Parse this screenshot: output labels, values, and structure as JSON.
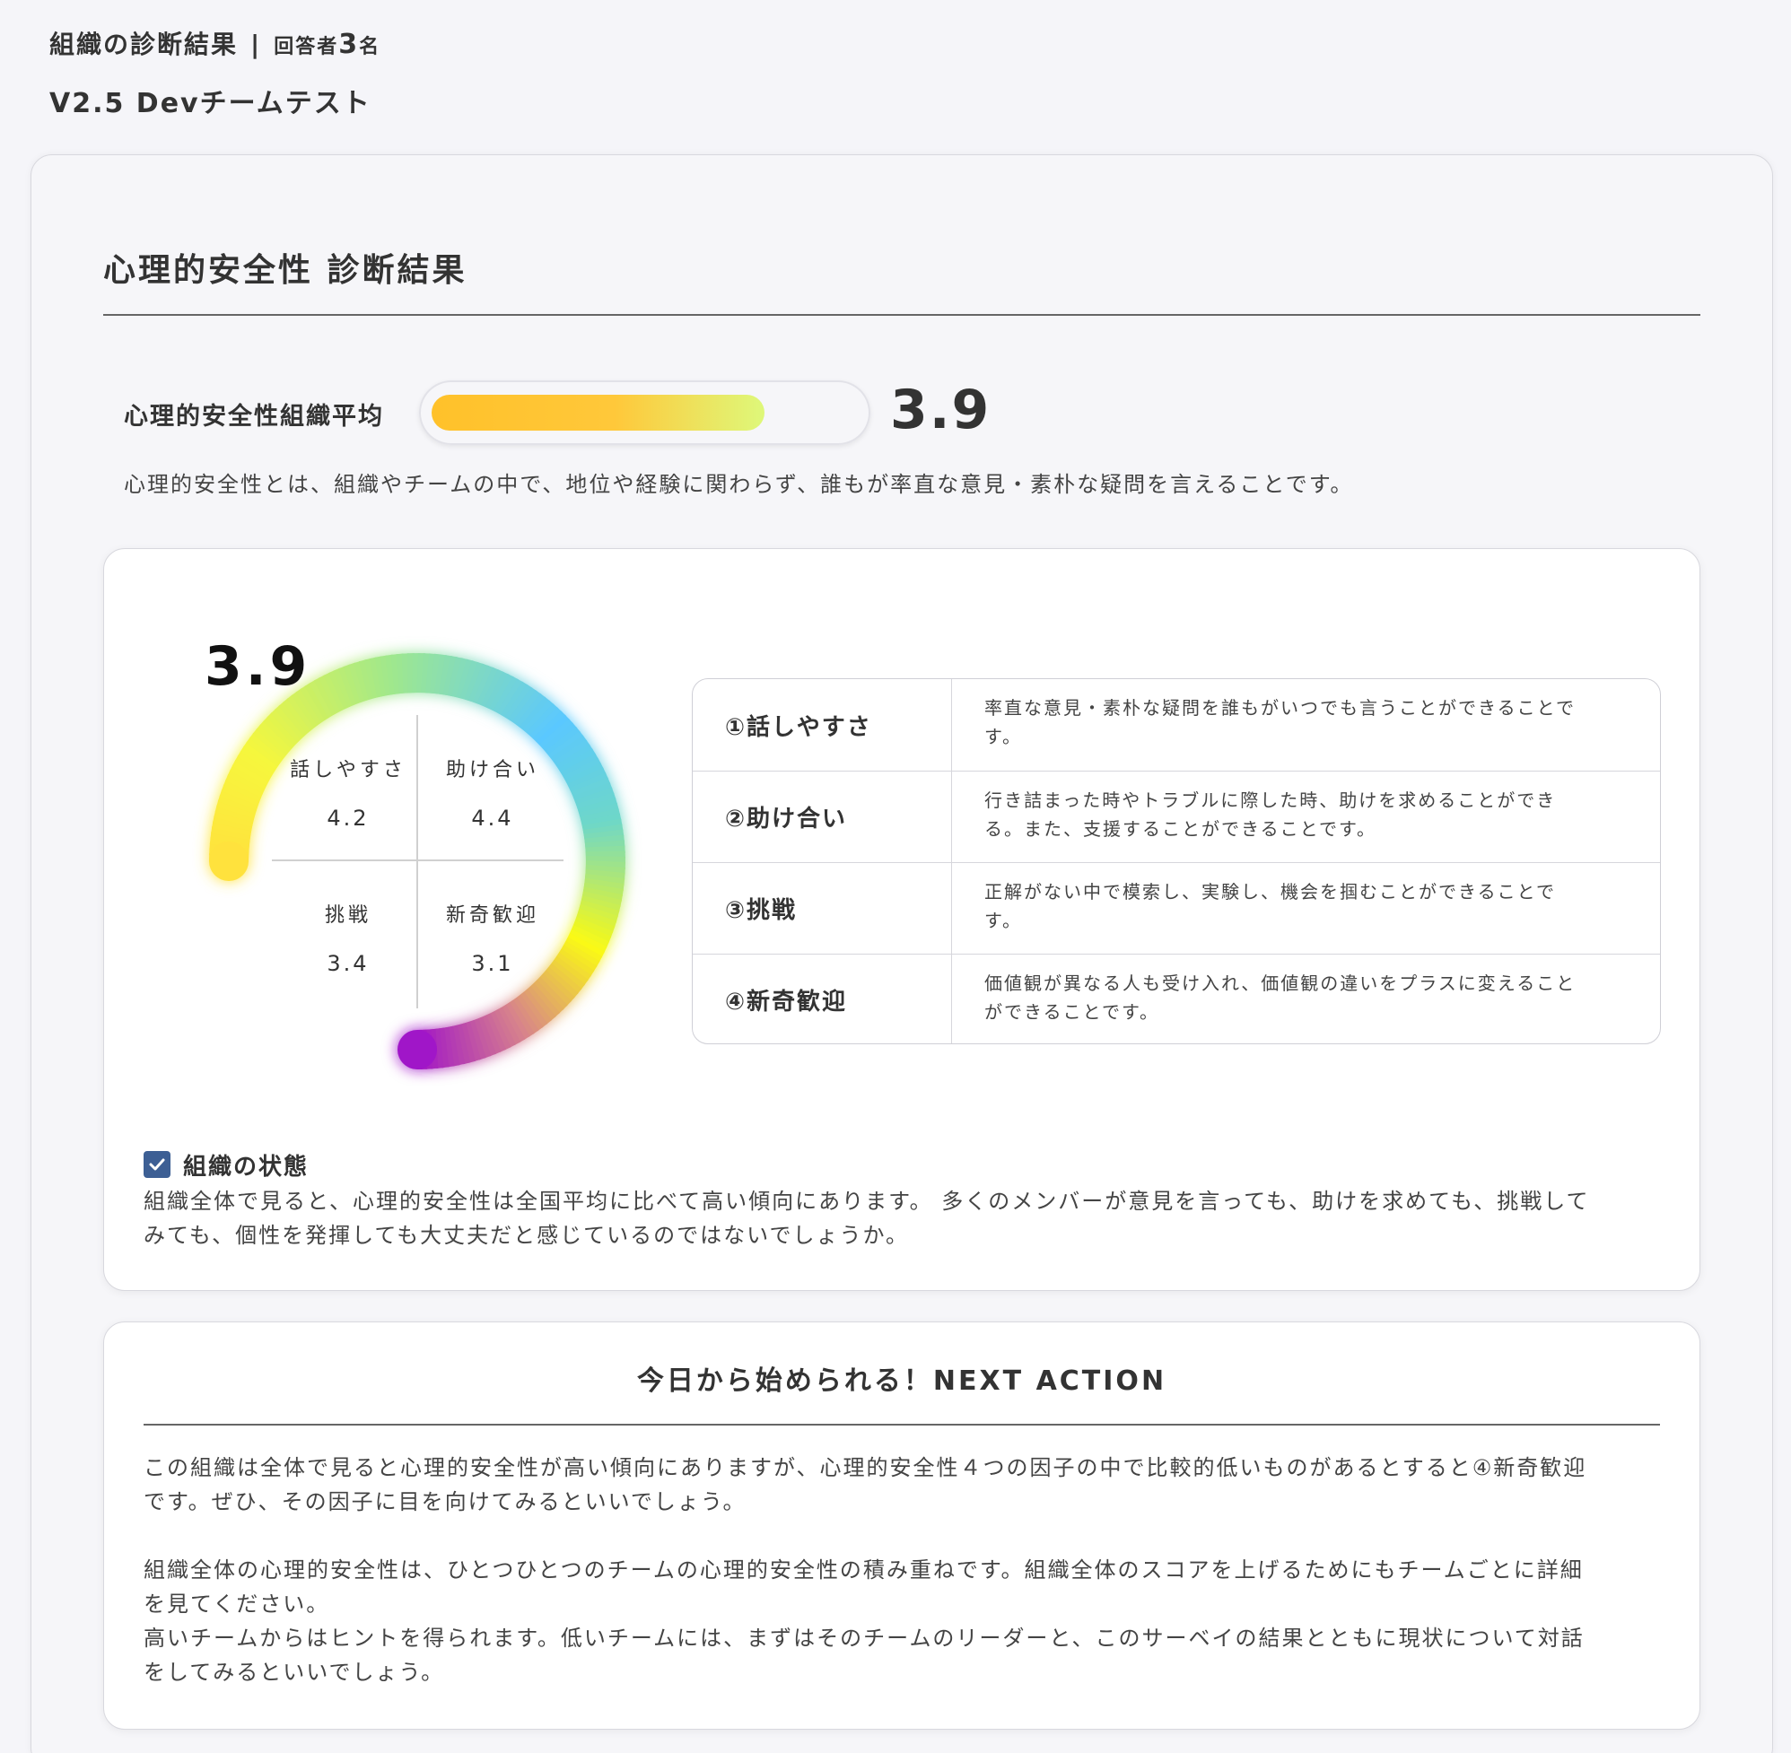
{
  "header": {
    "title": "組織の診断結果",
    "separator": "|",
    "respondents_prefix": "回答者",
    "respondents_count": "3",
    "respondents_suffix": "名",
    "subtitle": "V2.5 Devチームテスト"
  },
  "section": {
    "title": "心理的安全性 診断結果"
  },
  "average": {
    "label": "心理的安全性組織平均",
    "value": "3.9",
    "fill_fraction": 0.78,
    "description": "心理的安全性とは、組織やチームの中で、地位や経験に関わらず、誰もが率直な意見・素朴な疑問を言えることです。"
  },
  "gauge": {
    "score": "3.9",
    "colors": [
      "#ffe14d",
      "#f7f72a",
      "#66c8ff",
      "#ff1",
      "#9d16c2"
    ],
    "factors": [
      {
        "name": "話しやすさ",
        "value": "4.2"
      },
      {
        "name": "助け合い",
        "value": "4.4"
      },
      {
        "name": "挑戦",
        "value": "3.4"
      },
      {
        "name": "新奇歓迎",
        "value": "3.1"
      }
    ]
  },
  "factor_table": [
    {
      "name": "①話しやすさ",
      "desc_lines": [
        "率直な意見・素朴な疑問を誰もがいつでも言うことができることで",
        "す。"
      ]
    },
    {
      "name": "②助け合い",
      "desc_lines": [
        "行き詰まった時やトラブルに際した時、助けを求めることができ",
        "る。また、支援することができることです。"
      ]
    },
    {
      "name": "③挑戦",
      "desc_lines": [
        "正解がない中で模索し、実験し、機会を掴むことができることで",
        "す。"
      ]
    },
    {
      "name": "④新奇歓迎",
      "desc_lines": [
        "価値観が異なる人も受け入れ、価値観の違いをプラスに変えること",
        "ができることです。"
      ]
    }
  ],
  "status": {
    "title": "組織の状態",
    "lines": [
      "組織全体で見ると、心理的安全性は全国平均に比べて高い傾向にあります。 多くのメンバーが意見を言っても、助けを求めても、挑戦して",
      "みても、個性を発揮しても大丈夫だと感じているのではないでしょうか。"
    ]
  },
  "next_action": {
    "title": "今日から始められる！NEXT ACTION",
    "p1": [
      "この組織は全体で見ると心理的安全性が高い傾向にありますが、心理的安全性４つの因子の中で比較的低いものがあるとすると④新奇歓迎",
      "です。ぜひ、その因子に目を向けてみるといいでしょう。"
    ],
    "p2": [
      "組織全体の心理的安全性は、ひとつひとつのチームの心理的安全性の積み重ねです。組織全体のスコアを上げるためにもチームごとに詳細",
      "を見てください。",
      "高いチームからはヒントを得られます。低いチームには、まずはそのチームのリーダーと、このサーベイの結果とともに現状について対話",
      "をしてみるといいでしょう。"
    ]
  }
}
